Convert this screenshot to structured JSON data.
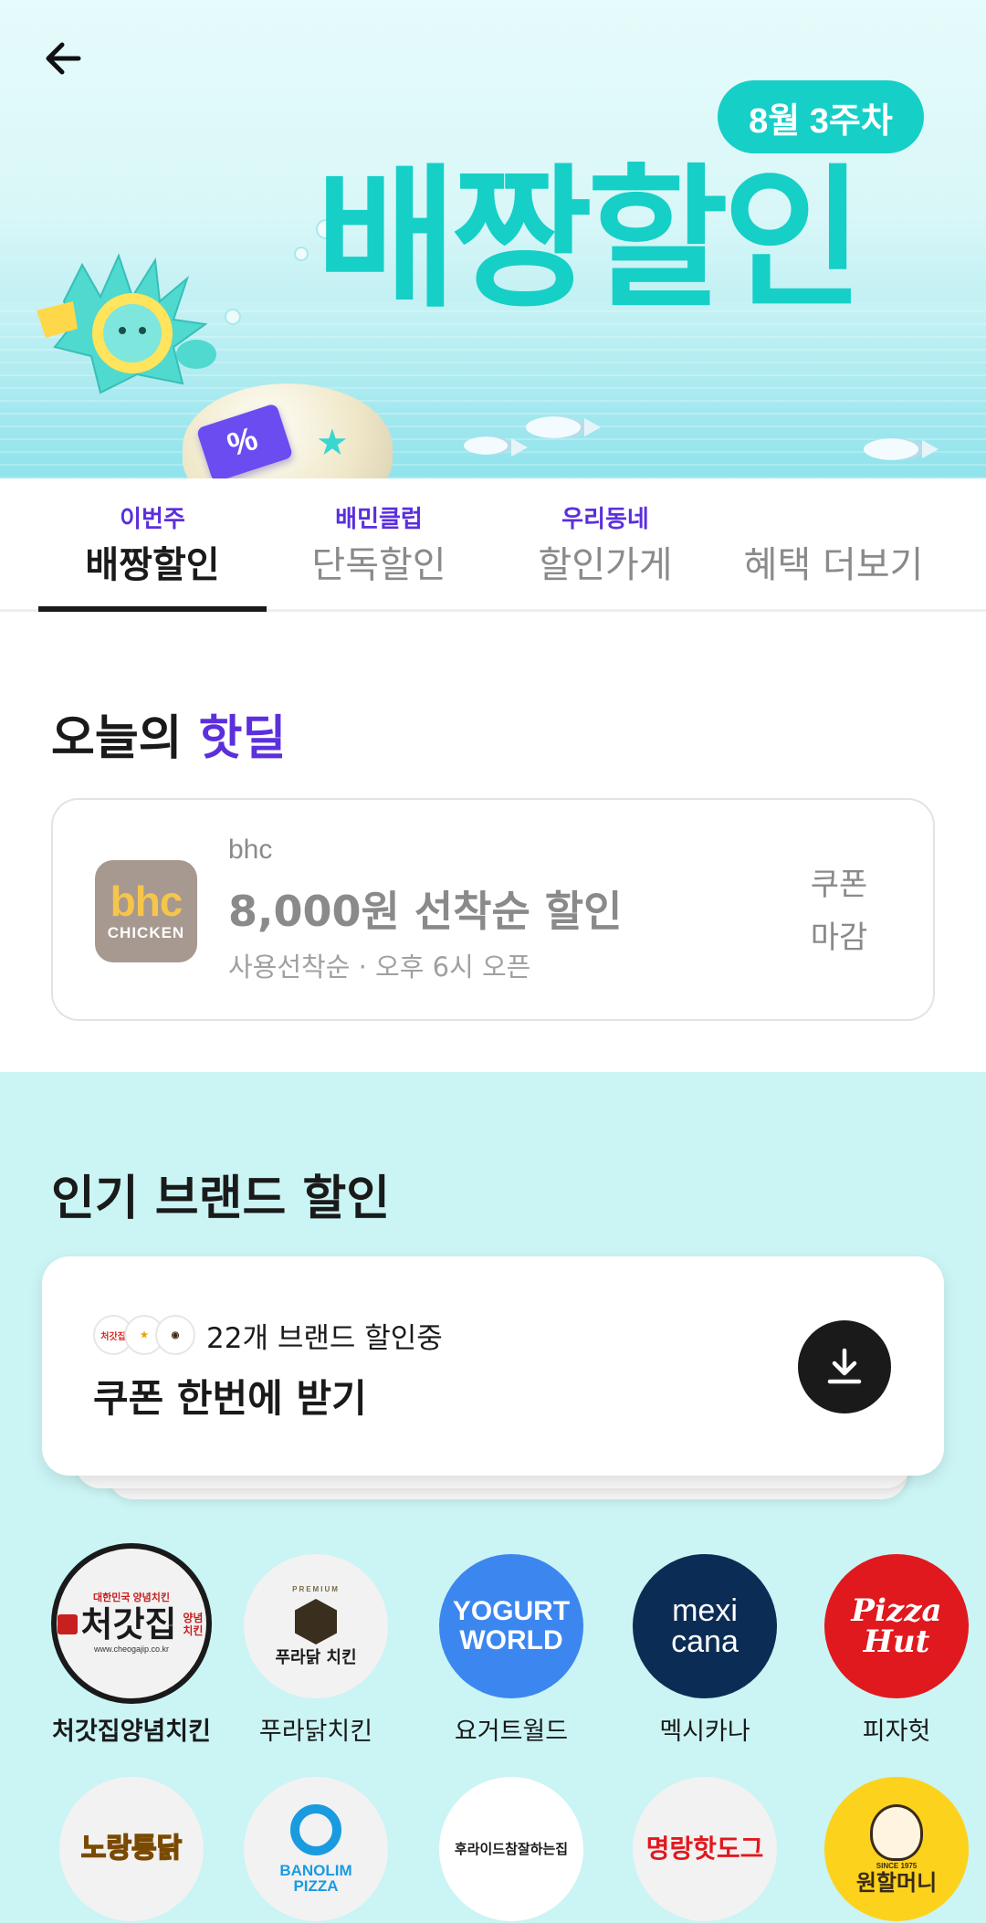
{
  "banner": {
    "week_badge": "8월 3주차",
    "title": "배짱할인"
  },
  "tabs": [
    {
      "sub": "이번주",
      "label": "배짱할인",
      "active": true
    },
    {
      "sub": "배민클럽",
      "label": "단독할인",
      "active": false
    },
    {
      "sub": "우리동네",
      "label": "할인가게",
      "active": false
    },
    {
      "sub": "",
      "label": "혜택 더보기",
      "active": false
    }
  ],
  "hot_deal": {
    "title_prefix": "오늘의",
    "title_accent": "핫딜",
    "logo_line1": "bhc",
    "logo_line2": "CHICKEN",
    "brand": "bhc",
    "headline": "8,000원 선착순 할인",
    "subtext": "사용선착순 · 오후 6시 오픈",
    "status_line1": "쿠폰",
    "status_line2": "마감"
  },
  "popular": {
    "title": "인기 브랜드 할인",
    "coupon_count": "22개 브랜드 할인중",
    "coupon_cta": "쿠폰 한번에 받기",
    "brands_row1": [
      {
        "name": "처갓집양념치킨",
        "logo_text": "처갓집",
        "logo_sub": "양념치킨",
        "logo_tagline": "대한민국 양념치킨",
        "logo_url_text": "www.cheogajip.co.kr"
      },
      {
        "name": "푸라닭치킨",
        "logo_text": "푸라닭 치킨",
        "logo_tagline": "PREMIUM"
      },
      {
        "name": "요거트월드",
        "logo_text": "YOGURT",
        "logo_sub": "WORLD"
      },
      {
        "name": "멕시카나",
        "logo_text": "mexi",
        "logo_sub": "cana"
      },
      {
        "name": "피자헛",
        "logo_text": "Pizza",
        "logo_sub": "Hut"
      }
    ],
    "brands_row2": [
      {
        "logo_text": "노랑통닭"
      },
      {
        "logo_text": "BANOLIM",
        "logo_sub": "PIZZA"
      },
      {
        "logo_text": "후라이드참잘하는집"
      },
      {
        "logo_text": "명랑핫도그"
      },
      {
        "logo_text": "원할머니",
        "logo_sub": "SINCE 1975"
      }
    ]
  },
  "colors": {
    "accent_purple": "#5b2fdc",
    "mint": "#16cfc7",
    "section_bg": "#cbf4f4"
  }
}
